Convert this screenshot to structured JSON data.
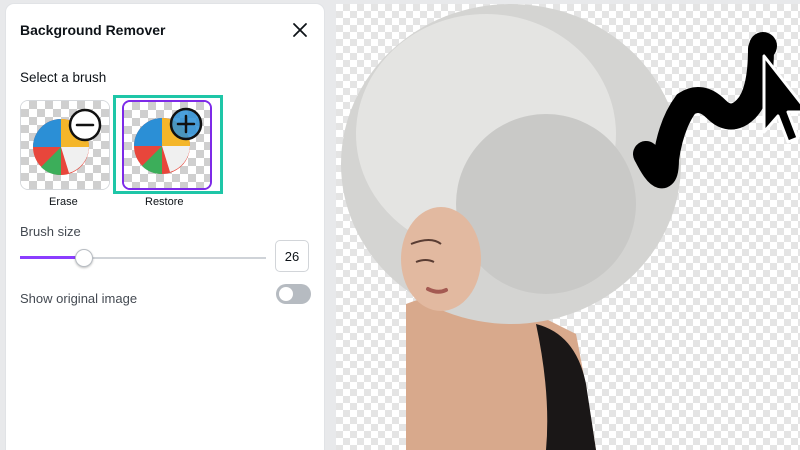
{
  "panel": {
    "title": "Background Remover",
    "select_brush_label": "Select a brush",
    "brushes": [
      {
        "label": "Erase",
        "icon": "minus-circle-icon",
        "selected": false
      },
      {
        "label": "Restore",
        "icon": "plus-circle-icon",
        "selected": true
      }
    ],
    "brush_size_label": "Brush size",
    "brush_size_value": "26",
    "brush_size_fraction": 0.26,
    "show_original_label": "Show original image",
    "show_original_on": false
  },
  "colors": {
    "accent": "#8b3dff",
    "selection_ring": "#1ec6a7",
    "toggle_off": "#b6bbc1"
  }
}
